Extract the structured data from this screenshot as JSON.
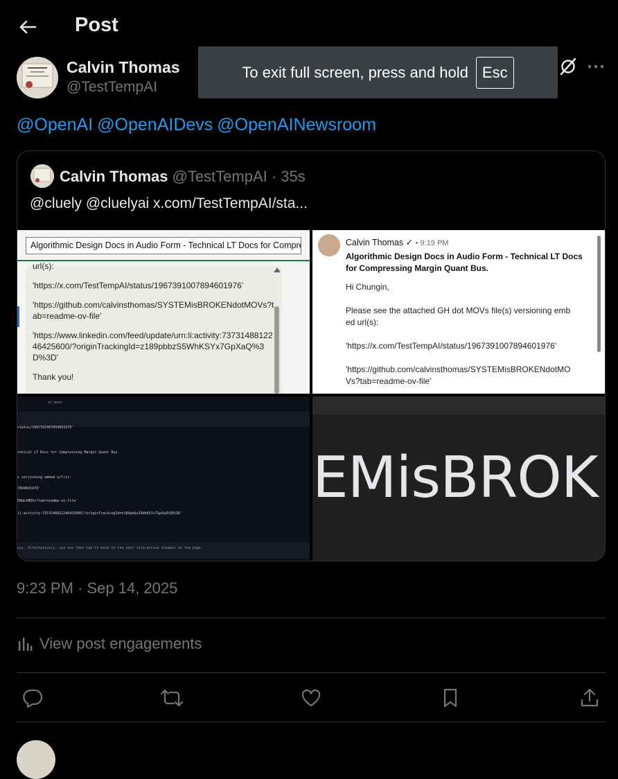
{
  "header": {
    "title": "Post"
  },
  "author": {
    "name": "Calvin Thomas",
    "handle": "@TestTempAI"
  },
  "toast": {
    "text": "To exit full screen, press and hold",
    "key": "Esc"
  },
  "mentions": [
    "@OpenAI",
    "@OpenAIDevs",
    "@OpenAINewsroom"
  ],
  "quote": {
    "name": "Calvin Thomas",
    "handle_time": "@TestTempAI · 35s",
    "text": "@cluely @cluelyai  x.com/TestTempAI/sta..."
  },
  "media": {
    "tile1": {
      "bar_text": "Algorithmic Design Docs in Audio Form - Technical LT Docs for Compressin",
      "lines": [
        "url(s):",
        "'https://x.com/TestTempAI/status/1967391007894601976'",
        "'https://github.com/calvinsthomas/SYSTEMisBROKENdotMOVs?tab=readme-ov-file'",
        "'https://www.linkedin.com/feed/update/urn:li:activity:7373148812246425600/?originTrackingId=z189pbbzS5WhKSYx7GpXaQ%3D%3D'",
        "Thank you!"
      ]
    },
    "tile2": {
      "sender": "Calvin Thomas",
      "time": "• 9:19 PM",
      "subject": "Algorithmic Design Docs in Audio Form - Technical LT Docs for Compressing Margin Quant Bus.",
      "lines": [
        "Hi Chungin,",
        "Please see the attached GH dot MOVs file(s) versioning embed url(s):",
        "'https://x.com/TestTempAI/status/1967391007894601976'",
        "'https://github.com/calvinsthomas/SYSTEMisBROKENdotMOVs?tab=readme-ov-file'"
      ]
    },
    "tile3": {
      "branch": "in main",
      "lines": [
        "status/1967391007894601976'",
        "chnical LT Docs for Compressing Margin Quant Bus.",
        "s versioning embed url(s):",
        "7894601976'",
        "ENdotMOVs?tab=readme-ov-file'",
        "li:activity:7373148812246425600/?originTrackingId=z189pbbzS5WhKSYx7GpXaQ%3D%3D'",
        "cus. Alternatively, use  esc  then  tab  to move to the next interactive element on the page."
      ]
    },
    "tile4": {
      "text": "EMisBROK"
    }
  },
  "timestamp": "9:23 PM · Sep 14, 2025",
  "engagements_label": "View post engagements",
  "colors": {
    "background": "#000000",
    "link": "#1d9bf0",
    "muted": "#71767b",
    "border": "#2f3336"
  },
  "icons": [
    "back-arrow-icon",
    "grok-icon",
    "more-icon",
    "analytics-icon",
    "reply-icon",
    "repost-icon",
    "like-icon",
    "bookmark-icon",
    "share-icon"
  ]
}
